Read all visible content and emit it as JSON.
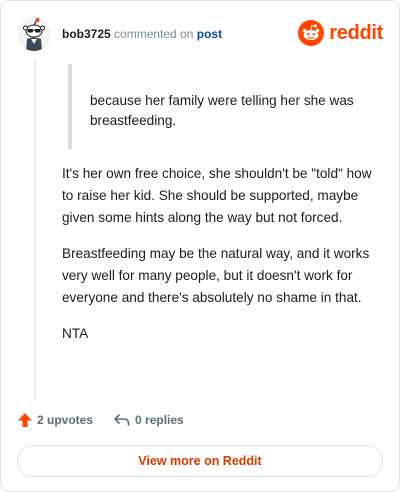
{
  "header": {
    "username": "bob3725",
    "action_text": "commented on",
    "post_link": "post",
    "brand": "reddit",
    "avatar_icon": "snoo-avatar-icon",
    "brand_icon": "reddit-logo-icon",
    "brand_color": "#ff4500"
  },
  "comment": {
    "quote": "because her family were telling her she was breastfeeding.",
    "paragraphs": [
      "It's her own free choice, she shouldn't be \"told\" how to raise her kid. She should be supported, maybe given some hints along the way but not forced.",
      "Breastfeeding may be the natural way, and it works very well for many people, but it doesn't work for everyone and there's absolutely no shame in that.",
      "NTA"
    ]
  },
  "footer": {
    "upvotes": "2 upvotes",
    "replies": "0 replies",
    "upvote_icon": "upvote-arrow-icon",
    "reply_icon": "reply-arrow-icon",
    "upvote_color": "#ff4500"
  },
  "cta": {
    "label": "View more on Reddit",
    "color": "#d93a00"
  }
}
